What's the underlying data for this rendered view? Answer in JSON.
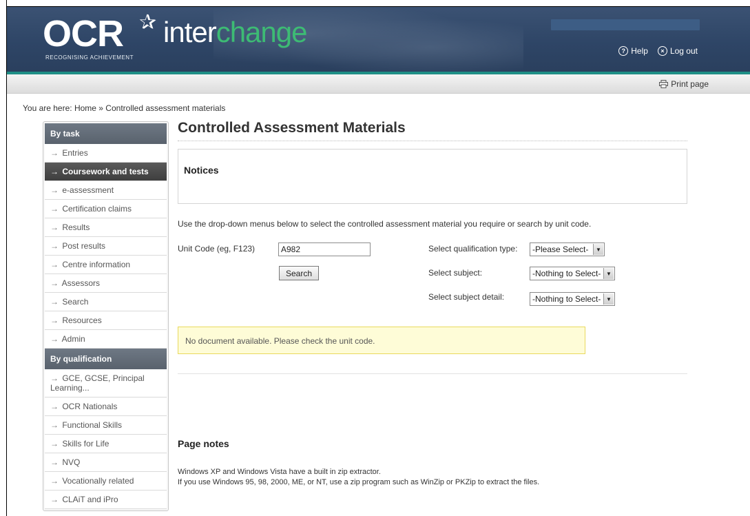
{
  "header": {
    "logo_main": "OCR",
    "logo_star": "✰",
    "logo_tagline": "RECOGNISING ACHIEVEMENT",
    "product_part1": "inter",
    "product_part2": "change",
    "help_label": "Help",
    "logout_label": "Log out"
  },
  "toolbar": {
    "print_label": "Print page"
  },
  "breadcrumb": "You are here: Home » Controlled assessment materials",
  "sidebar": {
    "by_task_heading": "By task",
    "task_items": [
      {
        "label": "Entries"
      },
      {
        "label": "Coursework and tests"
      },
      {
        "label": "e-assessment"
      },
      {
        "label": "Certification claims"
      },
      {
        "label": "Results"
      },
      {
        "label": "Post results"
      },
      {
        "label": "Centre information"
      },
      {
        "label": "Assessors"
      },
      {
        "label": "Search"
      },
      {
        "label": "Resources"
      },
      {
        "label": "Admin"
      }
    ],
    "by_qual_heading": "By qualification",
    "qual_items": [
      {
        "label": "GCE, GCSE, Principal Learning..."
      },
      {
        "label": "OCR Nationals"
      },
      {
        "label": "Functional Skills"
      },
      {
        "label": "Skills for Life"
      },
      {
        "label": "NVQ"
      },
      {
        "label": "Vocationally related"
      },
      {
        "label": "CLAiT and iPro"
      }
    ],
    "active_item": "Coursework and tests"
  },
  "main": {
    "title": "Controlled Assessment Materials",
    "notices_heading": "Notices",
    "intro": "Use the drop-down menus below to select the controlled assessment material you require or search by unit code.",
    "unit_code_label": "Unit Code (eg, F123)",
    "unit_code_value": "A982",
    "search_label": "Search",
    "qual_type_label": "Select qualification type:",
    "qual_type_value": "-Please Select-",
    "subject_label": "Select subject:",
    "subject_value": "-Nothing to Select-",
    "subject_detail_label": "Select subject detail:",
    "subject_detail_value": "-Nothing to Select-",
    "message": "No document available. Please check the unit code.",
    "page_notes_heading": "Page notes",
    "note1": "Windows XP and Windows Vista have a built in zip extractor.",
    "note2": "If you use Windows 95, 98, 2000, ME, or NT, use a zip program such as WinZip or PKZip to extract the files."
  },
  "colors": {
    "header_bg": "#2e4566",
    "accent_green": "#3dbb74",
    "teal_line": "#1f8f86",
    "sidebar_heading": "#59626d",
    "active_item_bg": "#3e3e3e",
    "message_bg": "#fefcd7",
    "message_border": "#e9d95c"
  }
}
